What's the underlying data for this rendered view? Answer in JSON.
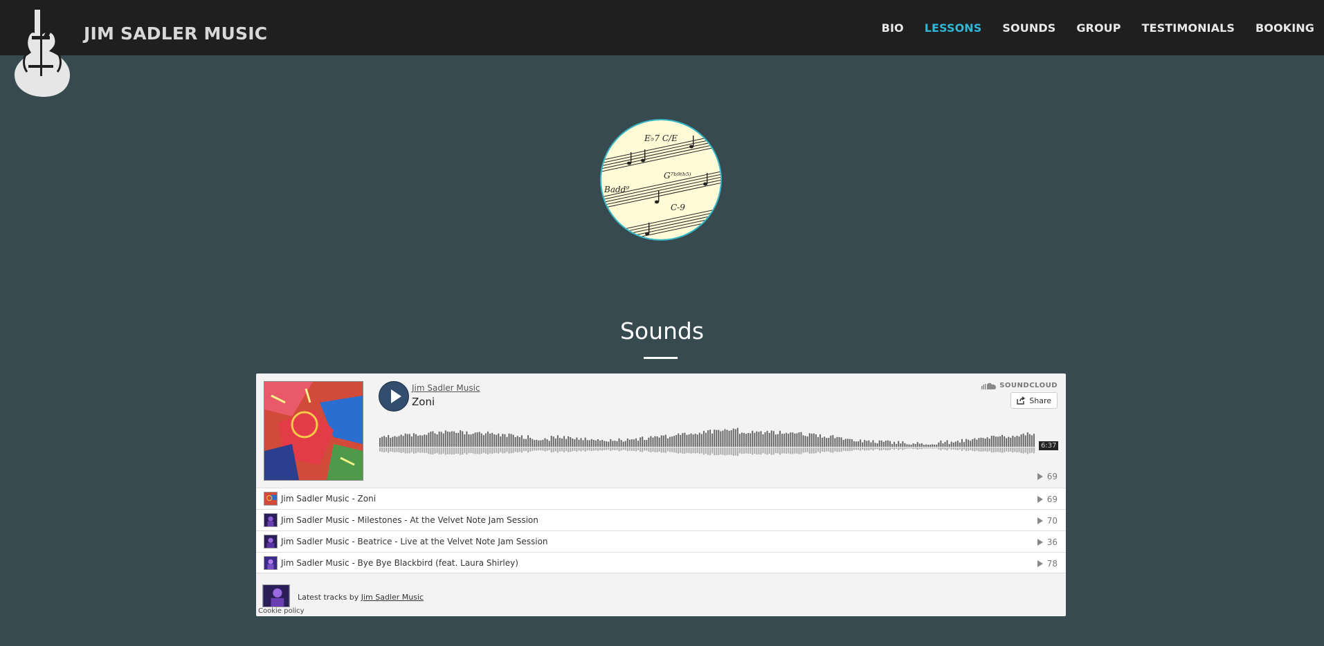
{
  "header": {
    "brand": "JIM SADLER MUSIC",
    "logo_icon": "guitar-icon",
    "nav": [
      {
        "label": "BIO",
        "active": false
      },
      {
        "label": "LESSONS",
        "active": true
      },
      {
        "label": "SOUNDS",
        "active": false
      },
      {
        "label": "GROUP",
        "active": false
      },
      {
        "label": "TESTIMONIALS",
        "active": false
      },
      {
        "label": "BOOKING",
        "active": false
      }
    ],
    "accent_color": "#2fb8d8"
  },
  "hero": {
    "image": "sheet-music-image"
  },
  "section": {
    "title": "Sounds"
  },
  "player": {
    "brand": "SOUNDCLOUD",
    "share_label": "Share",
    "artist": "Jim Sadler Music",
    "current_track": "Zoni",
    "duration": "6:37",
    "plays": "69",
    "tracks": [
      {
        "title": "Jim Sadler Music - Zoni",
        "plays": "69"
      },
      {
        "title": "Jim Sadler Music - Milestones - At the Velvet Note Jam Session",
        "plays": "70"
      },
      {
        "title": "Jim Sadler Music - Beatrice - Live at the Velvet Note Jam Session",
        "plays": "36"
      },
      {
        "title": "Jim Sadler Music - Bye Bye Blackbird (feat. Laura Shirley)",
        "plays": "78"
      }
    ],
    "footer_prefix": "Latest tracks by",
    "footer_link": "Jim Sadler Music",
    "cookie": "Cookie policy"
  }
}
